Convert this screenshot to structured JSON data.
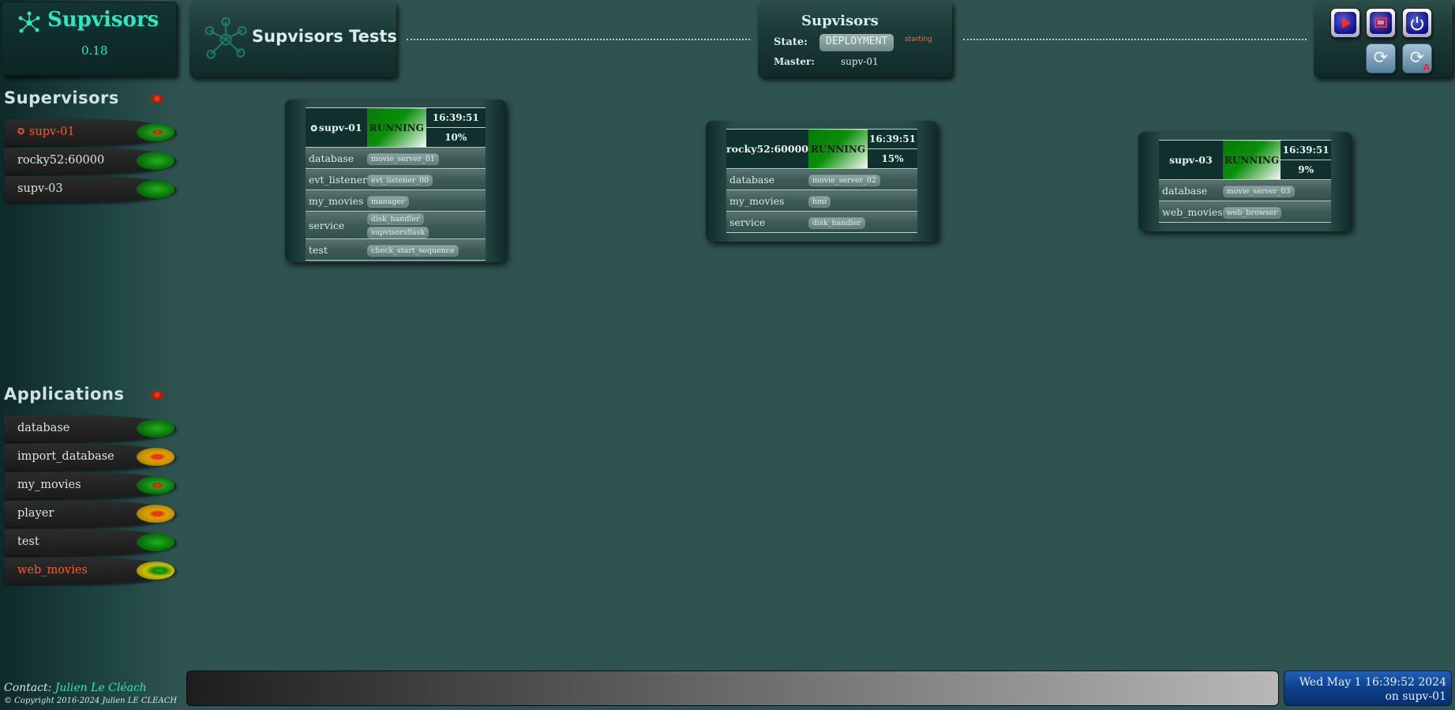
{
  "brand": {
    "name": "Supvisors",
    "version": "0.18"
  },
  "header": {
    "title": "Supvisors Tests"
  },
  "state": {
    "title": "Supvisors",
    "state_label": "State:",
    "state_value": "DEPLOYMENT",
    "state_sub": "starting",
    "master_label": "Master:",
    "master_value": "supv-01"
  },
  "controls": [
    {
      "name": "restart-button",
      "icon": "play-icon"
    },
    {
      "name": "shutdown-button",
      "icon": "screen-icon"
    },
    {
      "name": "power-button",
      "icon": "power-icon"
    },
    {
      "name": "refresh-button",
      "icon": "refresh-icon"
    },
    {
      "name": "auto-refresh-button",
      "icon": "auto-refresh-icon",
      "sub": "A"
    }
  ],
  "supervisors_menu": {
    "title": "Supervisors",
    "items": [
      {
        "label": "supv-01",
        "active": true,
        "status": "green-red"
      },
      {
        "label": "rocky52:60000",
        "active": false,
        "status": "green"
      },
      {
        "label": "supv-03",
        "active": false,
        "status": "green"
      }
    ]
  },
  "applications_menu": {
    "title": "Applications",
    "items": [
      {
        "label": "database",
        "active": false,
        "status": "green"
      },
      {
        "label": "import_database",
        "active": false,
        "status": "yellow-red"
      },
      {
        "label": "my_movies",
        "active": false,
        "status": "green-red"
      },
      {
        "label": "player",
        "active": false,
        "status": "yellow-red"
      },
      {
        "label": "test",
        "active": false,
        "status": "green"
      },
      {
        "label": "web_movies",
        "active": true,
        "status": "yellow-green"
      }
    ]
  },
  "cards": [
    {
      "name": "supv-01",
      "state": "RUNNING",
      "time": "16:39:51",
      "load": "10%",
      "master": true,
      "apps": [
        {
          "name": "database",
          "procs": [
            "movie_server_01"
          ]
        },
        {
          "name": "evt_listener",
          "procs": [
            "evt_listener_00"
          ]
        },
        {
          "name": "my_movies",
          "procs": [
            "manager"
          ]
        },
        {
          "name": "service",
          "procs": [
            "disk_handler",
            "supvisorsflask"
          ]
        },
        {
          "name": "test",
          "procs": [
            "check_start_sequence"
          ]
        }
      ]
    },
    {
      "name": "rocky52:60000",
      "state": "RUNNING",
      "time": "16:39:51",
      "load": "15%",
      "master": false,
      "apps": [
        {
          "name": "database",
          "procs": [
            "movie_server_02"
          ]
        },
        {
          "name": "my_movies",
          "procs": [
            "hmi"
          ]
        },
        {
          "name": "service",
          "procs": [
            "disk_handler"
          ]
        }
      ]
    },
    {
      "name": "supv-03",
      "state": "RUNNING",
      "time": "16:39:51",
      "load": "9%",
      "master": false,
      "apps": [
        {
          "name": "database",
          "procs": [
            "movie_server_03"
          ]
        },
        {
          "name": "web_movies",
          "procs": [
            "web_browser"
          ]
        }
      ]
    }
  ],
  "footer": {
    "contact_label": "Contact:",
    "contact_author": "Julien Le Cléach",
    "copyright": "© Copyright 2016-2024 Julien LE CLEACH",
    "message": "",
    "datetime": "Wed May 1 16:39:52 2024",
    "location": "on supv-01"
  },
  "colors": {
    "background": "#2f5350",
    "accent": "#2ee6c0",
    "active_text": "#ff5a28",
    "running": "#0a900a"
  }
}
